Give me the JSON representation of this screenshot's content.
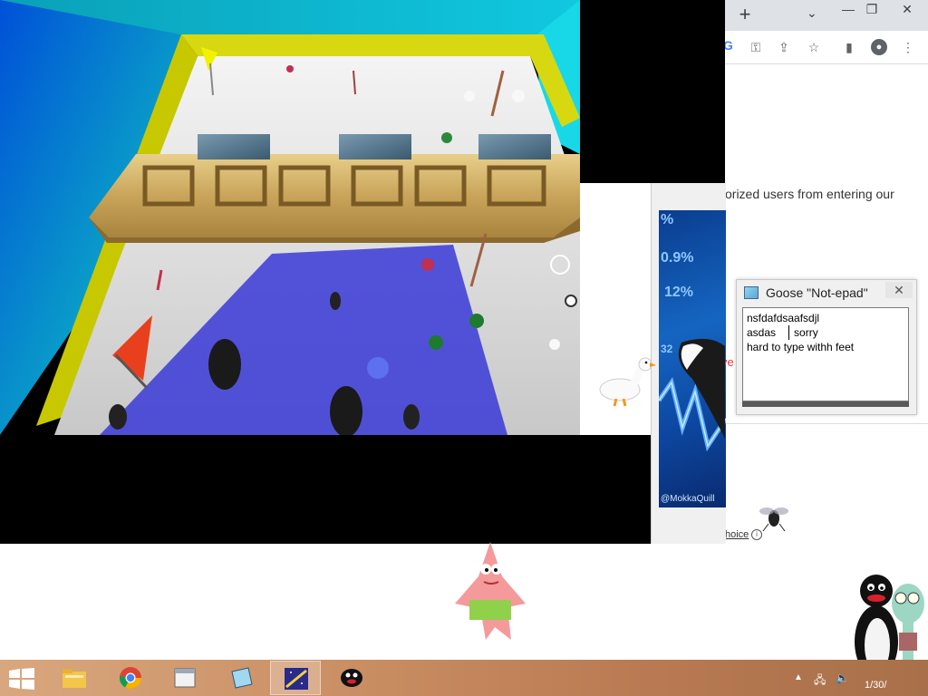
{
  "chrome": {
    "new_tab_symbol": "+",
    "tab_list_symbol": "⌄",
    "minimize_symbol": "—",
    "restore_symbol": "❐",
    "close_symbol": "✕",
    "google_letter": "G",
    "page_text_visible": "orized users from entering our",
    "choice_text": "hoice",
    "partial_red_text": "ve"
  },
  "stock_image": {
    "numbers": [
      "%",
      "0.9%",
      "12%",
      "32"
    ],
    "credit": "@MokkaQuill"
  },
  "notepad": {
    "title": "Goose \"Not-epad\"",
    "close_symbol": "✕",
    "text": "nsfdafdsaafsdjl\nasdas      sorry\nhard to type withh feet"
  },
  "taskbar": {
    "clock_partial": "1/30/",
    "apps": [
      {
        "name": "file-explorer",
        "active": false
      },
      {
        "name": "chrome",
        "active": false
      },
      {
        "name": "windows-explorer",
        "active": false
      },
      {
        "name": "notepad",
        "active": false
      },
      {
        "name": "game",
        "active": true
      },
      {
        "name": "pingu",
        "active": false
      }
    ]
  },
  "colors": {
    "taskbar": "#c98d62",
    "game_wall_cyan": "#00c8e6",
    "game_wall_yellow": "#e6e600",
    "game_floor_blue": "#4444dd"
  }
}
